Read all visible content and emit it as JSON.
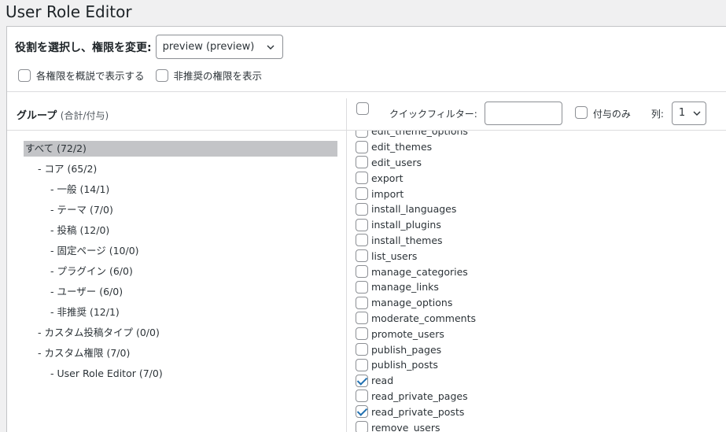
{
  "page": {
    "title": "User Role Editor"
  },
  "role": {
    "label": "役割を選択し、権限を変更:",
    "selected": "preview (preview)"
  },
  "options": {
    "show_human_readable": "各権限を概説で表示する",
    "show_deprecated": "非推奨の権限を表示"
  },
  "groups": {
    "heading": "グループ",
    "heading_sub": "(合計/付与)",
    "items": [
      {
        "label": "すべて (72/2)",
        "indent": 0,
        "selected": true
      },
      {
        "label": "- コア (65/2)",
        "indent": 1
      },
      {
        "label": "- 一般 (14/1)",
        "indent": 2
      },
      {
        "label": "- テーマ (7/0)",
        "indent": 2
      },
      {
        "label": "- 投稿 (12/0)",
        "indent": 2
      },
      {
        "label": "- 固定ページ (10/0)",
        "indent": 2
      },
      {
        "label": "- プラグイン (6/0)",
        "indent": 2
      },
      {
        "label": "- ユーザー (6/0)",
        "indent": 2
      },
      {
        "label": "- 非推奨 (12/1)",
        "indent": 2
      },
      {
        "label": "- カスタム投稿タイプ (0/0)",
        "indent": 1
      },
      {
        "label": "- カスタム権限 (7/0)",
        "indent": 1
      },
      {
        "label": "- User Role Editor (7/0)",
        "indent": 2
      }
    ]
  },
  "filter": {
    "quick_filter_label": "クイックフィルター:",
    "quick_filter_value": "",
    "granted_only_label": "付与のみ",
    "columns_label": "列:",
    "columns_value": "1"
  },
  "capabilities": [
    {
      "name": "edit_theme_options",
      "checked": false
    },
    {
      "name": "edit_themes",
      "checked": false
    },
    {
      "name": "edit_users",
      "checked": false
    },
    {
      "name": "export",
      "checked": false
    },
    {
      "name": "import",
      "checked": false
    },
    {
      "name": "install_languages",
      "checked": false
    },
    {
      "name": "install_plugins",
      "checked": false
    },
    {
      "name": "install_themes",
      "checked": false
    },
    {
      "name": "list_users",
      "checked": false
    },
    {
      "name": "manage_categories",
      "checked": false
    },
    {
      "name": "manage_links",
      "checked": false
    },
    {
      "name": "manage_options",
      "checked": false
    },
    {
      "name": "moderate_comments",
      "checked": false
    },
    {
      "name": "promote_users",
      "checked": false
    },
    {
      "name": "publish_pages",
      "checked": false
    },
    {
      "name": "publish_posts",
      "checked": false
    },
    {
      "name": "read",
      "checked": true
    },
    {
      "name": "read_private_pages",
      "checked": false
    },
    {
      "name": "read_private_posts",
      "checked": true
    },
    {
      "name": "remove_users",
      "checked": false
    }
  ],
  "colors": {
    "accent": "#2271b1",
    "selected_group_bg": "#c3c4c7"
  }
}
